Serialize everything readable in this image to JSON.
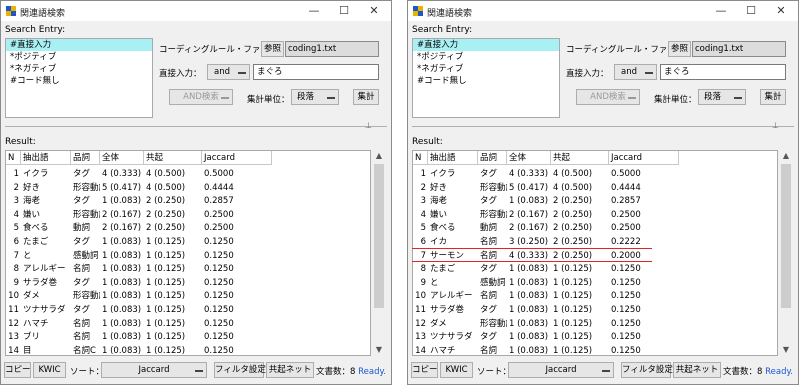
{
  "window": {
    "title": "関連語検索",
    "minimize": "—",
    "maximize": "☐",
    "close": "✕"
  },
  "search_entry_label": "Search Entry:",
  "entries": [
    "#直接入力",
    "*ポジティブ",
    "*ネガティブ",
    "#コード無し"
  ],
  "coding_rule_label": "コーディングルール・ファイル：",
  "browse_label": "参照",
  "coding_file": "coding1.txt",
  "direct_input_label": "直接入力：",
  "and_select": "and",
  "search_value": "まぐろ",
  "and_search_label": "AND検索",
  "unit_label": "集計単位：",
  "unit_value": "段落",
  "count_button": "集計",
  "result_label": "Result:",
  "columns": [
    "N",
    "抽出語",
    "品詞",
    "全体",
    "共起",
    "Jaccard"
  ],
  "left_rows": [
    [
      "1",
      "イクラ",
      "タグ",
      "4 (0.333)",
      "4 (0.500)",
      "0.5000"
    ],
    [
      "2",
      "好き",
      "形容動詞",
      "5 (0.417)",
      "4 (0.500)",
      "0.4444"
    ],
    [
      "3",
      "海老",
      "タグ",
      "1 (0.083)",
      "2 (0.250)",
      "0.2857"
    ],
    [
      "4",
      "嫌い",
      "形容動詞",
      "2 (0.167)",
      "2 (0.250)",
      "0.2500"
    ],
    [
      "5",
      "食べる",
      "動詞",
      "2 (0.167)",
      "2 (0.250)",
      "0.2500"
    ],
    [
      "6",
      "たまご",
      "タグ",
      "1 (0.083)",
      "1 (0.125)",
      "0.1250"
    ],
    [
      "7",
      "と",
      "感動詞",
      "1 (0.083)",
      "1 (0.125)",
      "0.1250"
    ],
    [
      "8",
      "アレルギー",
      "名詞",
      "1 (0.083)",
      "1 (0.125)",
      "0.1250"
    ],
    [
      "9",
      "サラダ巻",
      "タグ",
      "1 (0.083)",
      "1 (0.125)",
      "0.1250"
    ],
    [
      "10",
      "ダメ",
      "形容動詞",
      "1 (0.083)",
      "1 (0.125)",
      "0.1250"
    ],
    [
      "11",
      "ツナサラダ",
      "タグ",
      "1 (0.083)",
      "1 (0.125)",
      "0.1250"
    ],
    [
      "12",
      "ハマチ",
      "名詞",
      "1 (0.083)",
      "1 (0.125)",
      "0.1250"
    ],
    [
      "13",
      "ブリ",
      "名詞",
      "1 (0.083)",
      "1 (0.125)",
      "0.1250"
    ],
    [
      "14",
      "目",
      "名詞C",
      "1 (0.083)",
      "1 (0.125)",
      "0.1250"
    ]
  ],
  "right_rows": [
    [
      "1",
      "イクラ",
      "タグ",
      "4 (0.333)",
      "4 (0.500)",
      "0.5000"
    ],
    [
      "2",
      "好き",
      "形容動詞",
      "5 (0.417)",
      "4 (0.500)",
      "0.4444"
    ],
    [
      "3",
      "海老",
      "タグ",
      "1 (0.083)",
      "2 (0.250)",
      "0.2857"
    ],
    [
      "4",
      "嫌い",
      "形容動詞",
      "2 (0.167)",
      "2 (0.250)",
      "0.2500"
    ],
    [
      "5",
      "食べる",
      "動詞",
      "2 (0.167)",
      "2 (0.250)",
      "0.2500"
    ],
    [
      "6",
      "イカ",
      "名詞",
      "3 (0.250)",
      "2 (0.250)",
      "0.2222"
    ],
    [
      "7",
      "サーモン",
      "名詞",
      "4 (0.333)",
      "2 (0.250)",
      "0.2000"
    ],
    [
      "8",
      "たまご",
      "タグ",
      "1 (0.083)",
      "1 (0.125)",
      "0.1250"
    ],
    [
      "9",
      "と",
      "感動詞",
      "1 (0.083)",
      "1 (0.125)",
      "0.1250"
    ],
    [
      "10",
      "アレルギー",
      "名詞",
      "1 (0.083)",
      "1 (0.125)",
      "0.1250"
    ],
    [
      "11",
      "サラダ巻",
      "タグ",
      "1 (0.083)",
      "1 (0.125)",
      "0.1250"
    ],
    [
      "12",
      "ダメ",
      "形容動詞",
      "1 (0.083)",
      "1 (0.125)",
      "0.1250"
    ],
    [
      "13",
      "ツナサラダ",
      "タグ",
      "1 (0.083)",
      "1 (0.125)",
      "0.1250"
    ],
    [
      "14",
      "ハマチ",
      "名詞",
      "1 (0.083)",
      "1 (0.125)",
      "0.1250"
    ]
  ],
  "bottom": {
    "copy": "コピー",
    "kwic": "KWIC",
    "sort_label": "ソート：",
    "sort_value": "Jaccard",
    "filter": "フィルタ設定",
    "network": "共起ネット",
    "doc_count": "文書数：8",
    "status": "Ready."
  },
  "highlight_color": "#e8202a",
  "selection_color": "#a8f0f4"
}
